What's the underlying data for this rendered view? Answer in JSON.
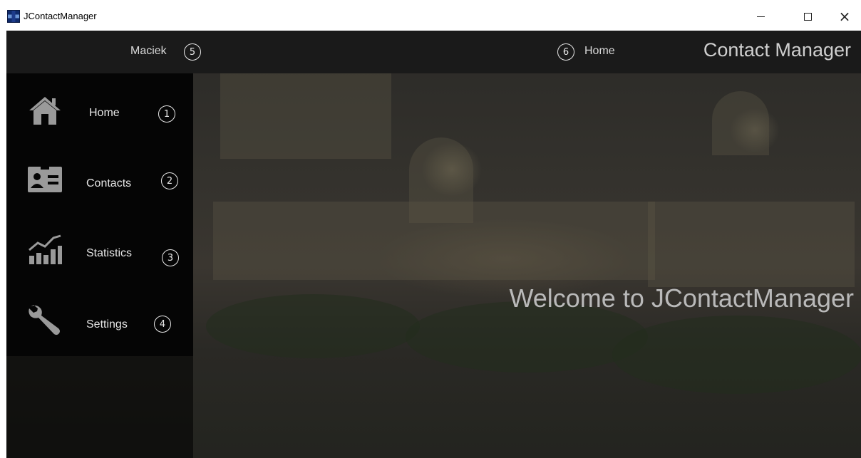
{
  "window": {
    "title": "JContactManager",
    "controls": {
      "minimize": "–",
      "maximize": "□",
      "close": "×"
    }
  },
  "topbar": {
    "user": "Maciek",
    "user_badge": "5",
    "breadcrumb_badge": "6",
    "breadcrumb": "Home",
    "app_title": "Contact Manager"
  },
  "sidebar": {
    "items": [
      {
        "label": "Home",
        "badge": "1",
        "icon": "home-icon"
      },
      {
        "label": "Contacts",
        "badge": "2",
        "icon": "contact-card-icon"
      },
      {
        "label": "Statistics",
        "badge": "3",
        "icon": "statistics-icon"
      },
      {
        "label": "Settings",
        "badge": "4",
        "icon": "wrench-icon"
      }
    ]
  },
  "main": {
    "welcome": "Welcome to JContactManager"
  },
  "colors": {
    "topbar": "#1a1a1a",
    "menu": "#050505",
    "text": "#e6e6e6"
  }
}
